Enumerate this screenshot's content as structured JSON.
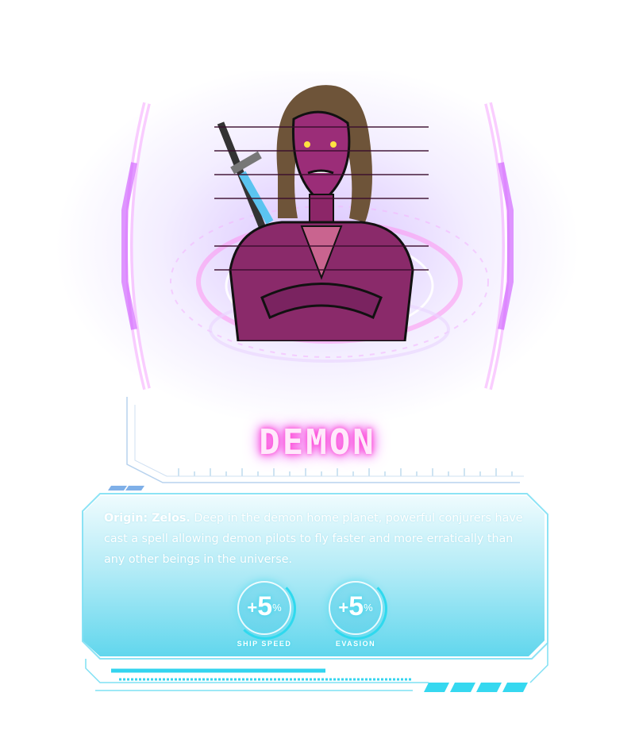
{
  "character": {
    "name": "DEMON",
    "origin_label": "Origin: Zelos.",
    "description": " Deep in the demon home planet, powerful conjurers have cast a spell allowing demon pilots to fly faster and more erratically than any other beings in the universe."
  },
  "stats": [
    {
      "plus": "+",
      "value": "5",
      "unit": "%",
      "label": "SHIP SPEED",
      "icon": "stat-ring"
    },
    {
      "plus": "+",
      "value": "5",
      "unit": "%",
      "label": "EVASION",
      "icon": "stat-ring"
    }
  ],
  "colors": {
    "accent_pink": "#ff4fd8",
    "accent_purple": "#a86bff",
    "accent_cyan": "#2fd9ee",
    "skin": "#8a2a6a"
  }
}
